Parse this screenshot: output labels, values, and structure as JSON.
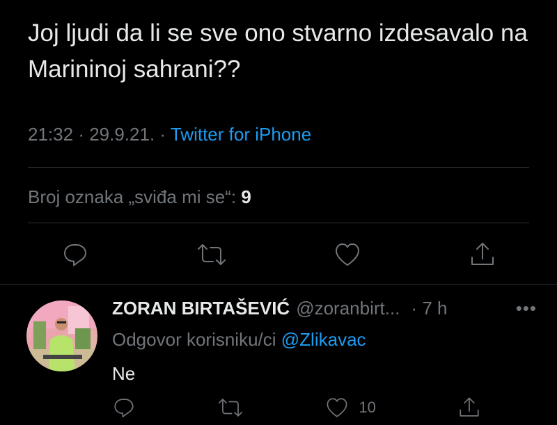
{
  "tweet": {
    "text": "Joj ljudi da li se sve ono stvarno izdesavalo na Marininoj sahrani??",
    "time": "21:32",
    "date": "29.9.21.",
    "source": "Twitter for iPhone",
    "likes_label": "Broj oznaka „sviđa mi se“:",
    "likes_count": "9"
  },
  "actions": {
    "icons": [
      "reply-icon",
      "retweet-icon",
      "like-icon",
      "share-icon"
    ]
  },
  "reply": {
    "name": "ZORAN BIRTAŠEVIĆ",
    "handle": "@zoranbirt...",
    "time": "7 h",
    "replying_label": "Odgovor korisniku/ci",
    "replying_to": "@Zlikavac",
    "text": "Ne",
    "like_count": "10"
  },
  "colors": {
    "background": "#000000",
    "accent": "#1d9bf0",
    "secondary_text": "#71767b",
    "divider": "#2f3336"
  }
}
